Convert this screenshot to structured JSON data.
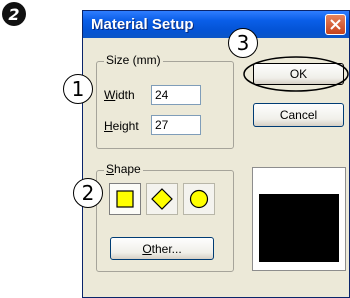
{
  "step_marker": "2",
  "dialog": {
    "title": "Material Setup",
    "close_icon": "close-x-icon"
  },
  "size_group": {
    "legend": "Size (mm)",
    "width_label_accel": "W",
    "width_label_rest": "idth",
    "width_value": "24",
    "height_label_accel": "H",
    "height_label_rest": "eight",
    "height_value": "27"
  },
  "shape_group": {
    "legend_accel": "S",
    "legend_rest": "hape",
    "shapes": [
      "square-icon",
      "diamond-icon",
      "circle-icon"
    ],
    "shape_fill_color": "#ffff00",
    "other_accel": "O",
    "other_rest": "ther..."
  },
  "buttons": {
    "ok": "OK",
    "cancel": "Cancel"
  },
  "callouts": {
    "one": "1",
    "two": "2",
    "three": "3"
  },
  "preview": {
    "fill_color": "#000000"
  }
}
